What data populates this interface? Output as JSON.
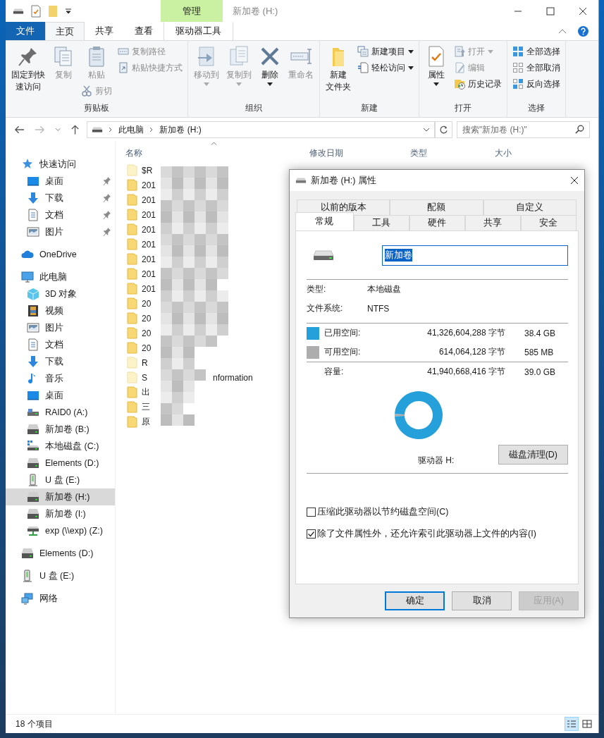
{
  "window": {
    "title": "新加卷 (H:)",
    "context_label": "管理"
  },
  "ribbon_tabs": [
    {
      "label": "文件",
      "kind": "file",
      "selected": false
    },
    {
      "label": "主页",
      "kind": "tab",
      "selected": true
    },
    {
      "label": "共享",
      "kind": "tab",
      "selected": false
    },
    {
      "label": "查看",
      "kind": "tab",
      "selected": false
    },
    {
      "label": "驱动器工具",
      "kind": "context",
      "selected": false
    }
  ],
  "ribbon_groups": [
    {
      "label": "剪贴板",
      "columns": [
        [
          {
            "kind": "large",
            "lines": [
              "固定到快",
              "速访问"
            ],
            "disabled": false,
            "dropdown": false
          }
        ],
        [
          {
            "kind": "large",
            "lines": [
              "复制"
            ],
            "disabled": true,
            "dropdown": false
          }
        ],
        [
          {
            "kind": "large",
            "lines": [
              "粘贴"
            ],
            "disabled": true,
            "dropdown": false
          },
          {
            "kind": "small",
            "label": "剪切",
            "disabled": true,
            "dropdown": false
          }
        ],
        [
          {
            "kind": "small",
            "label": "复制路径",
            "disabled": true,
            "dropdown": false
          },
          {
            "kind": "small",
            "label": "粘贴快捷方式",
            "disabled": true,
            "dropdown": false
          }
        ]
      ]
    },
    {
      "label": "组织",
      "columns": [
        [
          {
            "kind": "large",
            "lines": [
              "移动到"
            ],
            "disabled": true,
            "dropdown": true
          }
        ],
        [
          {
            "kind": "large",
            "lines": [
              "复制到"
            ],
            "disabled": true,
            "dropdown": true
          }
        ],
        [
          {
            "kind": "large",
            "lines": [
              "删除"
            ],
            "disabled": false,
            "dropdown": true
          }
        ],
        [
          {
            "kind": "large",
            "lines": [
              "重命名"
            ],
            "disabled": true,
            "dropdown": false
          }
        ]
      ]
    },
    {
      "label": "新建",
      "columns": [
        [
          {
            "kind": "large",
            "lines": [
              "新建",
              "文件夹"
            ],
            "disabled": false,
            "dropdown": false
          }
        ],
        [
          {
            "kind": "small",
            "label": "新建项目",
            "disabled": false,
            "dropdown": true
          },
          {
            "kind": "small",
            "label": "轻松访问",
            "disabled": false,
            "dropdown": true
          }
        ]
      ]
    },
    {
      "label": "打开",
      "columns": [
        [
          {
            "kind": "large",
            "lines": [
              "属性"
            ],
            "disabled": false,
            "dropdown": true
          }
        ],
        [
          {
            "kind": "small",
            "label": "打开",
            "disabled": true,
            "dropdown": true
          },
          {
            "kind": "small",
            "label": "编辑",
            "disabled": true,
            "dropdown": false
          },
          {
            "kind": "small",
            "label": "历史记录",
            "disabled": false,
            "dropdown": false
          }
        ]
      ]
    },
    {
      "label": "选择",
      "columns": [
        [
          {
            "kind": "small",
            "label": "全部选择",
            "disabled": false,
            "dropdown": false
          },
          {
            "kind": "small",
            "label": "全部取消",
            "disabled": false,
            "dropdown": false
          },
          {
            "kind": "small",
            "label": "反向选择",
            "disabled": false,
            "dropdown": false
          }
        ]
      ]
    }
  ],
  "address": {
    "crumbs": [
      "此电脑",
      "新加卷 (H:)"
    ],
    "search_placeholder": "搜索\"新加卷 (H:)\""
  },
  "nav": [
    {
      "label": "快速访问",
      "kind": "star",
      "selected": false,
      "children": [
        {
          "label": "桌面",
          "kind": "desktop",
          "pinned": true,
          "selected": false
        },
        {
          "label": "下载",
          "kind": "download",
          "pinned": true,
          "selected": false
        },
        {
          "label": "文档",
          "kind": "doc",
          "pinned": true,
          "selected": false
        },
        {
          "label": "图片",
          "kind": "pics",
          "pinned": true,
          "selected": false
        }
      ]
    },
    {
      "label": "OneDrive",
      "kind": "cloud",
      "selected": false
    },
    {
      "label": "此电脑",
      "kind": "pc",
      "selected": false,
      "children": [
        {
          "label": "3D 对象",
          "kind": "cube",
          "selected": false
        },
        {
          "label": "视频",
          "kind": "video",
          "selected": false
        },
        {
          "label": "图片",
          "kind": "pics",
          "selected": false
        },
        {
          "label": "文档",
          "kind": "doc",
          "selected": false
        },
        {
          "label": "下载",
          "kind": "download",
          "selected": false
        },
        {
          "label": "音乐",
          "kind": "music",
          "selected": false
        },
        {
          "label": "桌面",
          "kind": "desktop",
          "selected": false
        },
        {
          "label": "RAID0 (A:)",
          "kind": "raid",
          "selected": false
        },
        {
          "label": "新加卷 (B:)",
          "kind": "drive",
          "selected": false
        },
        {
          "label": "本地磁盘 (C:)",
          "kind": "sysdrive",
          "selected": false
        },
        {
          "label": "Elements (D:)",
          "kind": "drive",
          "selected": false
        },
        {
          "label": "U 盘 (E:)",
          "kind": "usb",
          "selected": false
        },
        {
          "label": "新加卷 (H:)",
          "kind": "drive",
          "selected": true
        },
        {
          "label": "新加卷 (I:)",
          "kind": "drive",
          "selected": false
        },
        {
          "label": "exp (\\\\exp) (Z:)",
          "kind": "netdrive",
          "selected": false
        }
      ]
    },
    {
      "label": "Elements (D:)",
      "kind": "drive",
      "selected": false
    },
    {
      "label": "U 盘 (E:)",
      "kind": "usb",
      "selected": false
    },
    {
      "label": "网络",
      "kind": "network",
      "selected": false
    }
  ],
  "files": {
    "columns": [
      "名称",
      "修改日期",
      "类型",
      "大小"
    ],
    "rows": [
      {
        "name": "$R",
        "hidden": true
      },
      {
        "name": "201",
        "hidden": false
      },
      {
        "name": "201",
        "hidden": false
      },
      {
        "name": "201",
        "hidden": false
      },
      {
        "name": "201",
        "hidden": false
      },
      {
        "name": "201",
        "hidden": false
      },
      {
        "name": "201",
        "hidden": false
      },
      {
        "name": "201",
        "hidden": false
      },
      {
        "name": "201",
        "hidden": false
      },
      {
        "name": "20",
        "hidden": false
      },
      {
        "name": "20",
        "hidden": false
      },
      {
        "name": "20",
        "hidden": false
      },
      {
        "name": "20",
        "hidden": false
      },
      {
        "name": "R",
        "hidden": true
      },
      {
        "name": "S",
        "hidden": true,
        "tail": "nformation"
      },
      {
        "name": "出",
        "hidden": false
      },
      {
        "name": "三",
        "hidden": false
      },
      {
        "name": "原",
        "hidden": false
      }
    ]
  },
  "status_bar": {
    "count": "18 个项目",
    "views": [
      {
        "kind": "details",
        "selected": true
      },
      {
        "kind": "tiles",
        "selected": false
      }
    ]
  },
  "dialog": {
    "title": "新加卷 (H:) 属性",
    "tabs_back": [
      {
        "label": "以前的版本",
        "selected": false
      },
      {
        "label": "配额",
        "selected": false
      },
      {
        "label": "自定义",
        "selected": false
      }
    ],
    "tabs_front": [
      {
        "label": "常规",
        "selected": true
      },
      {
        "label": "工具",
        "selected": false
      },
      {
        "label": "硬件",
        "selected": false
      },
      {
        "label": "共享",
        "selected": false
      },
      {
        "label": "安全",
        "selected": false
      }
    ],
    "volume_name": {
      "value": "新加卷",
      "text_selected": true
    },
    "info": [
      {
        "label": "类型:",
        "value": "本地磁盘"
      },
      {
        "label": "文件系统:",
        "value": "NTFS"
      }
    ],
    "space": [
      {
        "label": "已用空间:",
        "bytes": "41,326,604,288 字节",
        "size": "38.4 GB",
        "color": "#26a0da"
      },
      {
        "label": "可用空间:",
        "bytes": "614,064,128 字节",
        "size": "585 MB",
        "color": "#adadad"
      }
    ],
    "capacity": {
      "label": "容量:",
      "bytes": "41,940,668,416 字节",
      "size": "39.0 GB"
    },
    "chart_data": {
      "type": "donut",
      "values": [
        98.54,
        1.46
      ]
    },
    "drive_label": "驱动器 H:",
    "cleanup_button": "磁盘清理(D)",
    "options": [
      {
        "label": "压缩此驱动器以节约磁盘空间(C)",
        "checked": false
      },
      {
        "label": "除了文件属性外，还允许索引此驱动器上文件的内容(I)",
        "checked": true
      }
    ],
    "buttons": [
      {
        "label": "确定",
        "kind": "default",
        "disabled": false
      },
      {
        "label": "取消",
        "kind": "normal",
        "disabled": false
      },
      {
        "label": "应用(A)",
        "kind": "normal",
        "disabled": true
      }
    ]
  }
}
